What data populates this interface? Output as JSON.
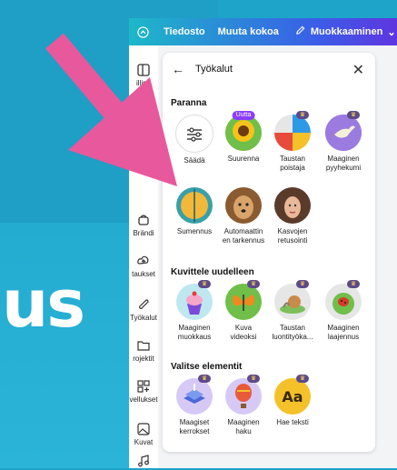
{
  "overlay_text": "us",
  "topbar": {
    "file_label": "Tiedosto",
    "resize_label": "Muuta kokoa",
    "edit_label": "Muokkaaminen"
  },
  "rail": [
    {
      "label": "illipo",
      "icon": "layout-icon"
    },
    {
      "label": "Brändi",
      "icon": "brand-icon"
    },
    {
      "label": "taukset",
      "icon": "upload-icon"
    },
    {
      "label": "Työkalut",
      "icon": "tools-icon"
    },
    {
      "label": "rojektit",
      "icon": "folder-icon"
    },
    {
      "label": "vellukset",
      "icon": "apps-icon"
    },
    {
      "label": "Kuvat",
      "icon": "image-icon"
    },
    {
      "label": "",
      "icon": "music-icon"
    }
  ],
  "panel": {
    "title": "Työkalut",
    "sections": [
      {
        "title": "Paranna"
      },
      {
        "title": "Kuvittele uudelleen"
      },
      {
        "title": "Valitse elementit"
      }
    ],
    "tools": {
      "saada": "Säädä",
      "suurenna": "Suurenna",
      "suurenna_badge": "Uutta",
      "taustan_poistaja_1": "Taustan",
      "taustan_poistaja_2": "poistaja",
      "pyyhekumi_1": "Maaginen",
      "pyyhekumi_2": "pyyhekumi",
      "sumennus": "Sumennus",
      "tarkennus_1": "Automaattin",
      "tarkennus_2": "en tarkennus",
      "kasvojen_1": "Kasvojen",
      "kasvojen_2": "retusointi",
      "muokkaus_1": "Maaginen",
      "muokkaus_2": "muokkaus",
      "videoksi_1": "Kuva",
      "videoksi_2": "videoksi",
      "luontityokalu_1": "Taustan",
      "luontityokalu_2": "luontityöka...",
      "laajennus_1": "Maaginen",
      "laajennus_2": "laajennus",
      "kerrokset_1": "Maagiset",
      "kerrokset_2": "kerrokset",
      "haku_1": "Maaginen",
      "haku_2": "haku",
      "teksti": "Hae teksti"
    }
  },
  "colors": {
    "arrow": "#e8589c",
    "background": "#2bb4d8",
    "accent": "#8b3dff"
  }
}
